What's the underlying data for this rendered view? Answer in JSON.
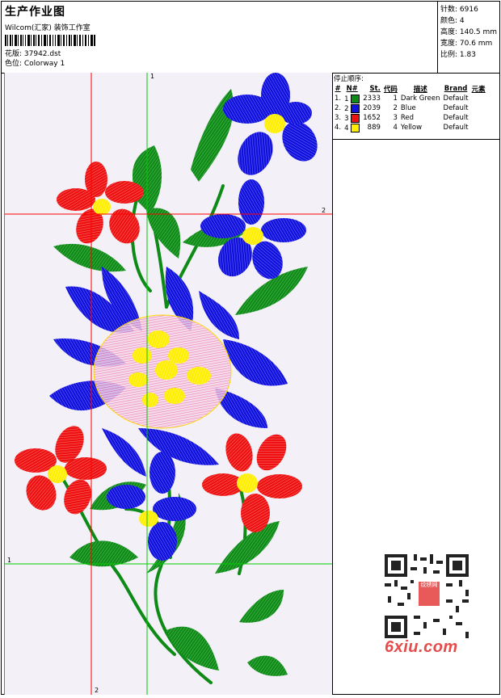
{
  "header": {
    "title": "生产作业图",
    "subtitle": "Wilcom(汇家) 装饰工作室",
    "design_label": "花版: 37942.dst",
    "colorway_label": "色位: Colorway 1"
  },
  "stats": {
    "stitches": "针数: 6916",
    "colors": "颜色: 4",
    "height": "高度: 140.5 mm",
    "width": "宽度: 70.6 mm",
    "scale": "比例: 1.83"
  },
  "stop_sequence": {
    "title": "停止顺序:",
    "columns": [
      "#",
      "N#",
      "St.",
      "代码",
      "描述",
      "Brand",
      "元素"
    ],
    "rows": [
      {
        "idx": "1.",
        "n": "1",
        "color": "#0e8a16",
        "st": "2333",
        "code": "1",
        "desc": "Dark Green",
        "brand": "Default"
      },
      {
        "idx": "2.",
        "n": "2",
        "color": "#1111dd",
        "st": "2039",
        "code": "2",
        "desc": "Blue",
        "brand": "Default"
      },
      {
        "idx": "3.",
        "n": "3",
        "color": "#ee1111",
        "st": "1652",
        "code": "3",
        "desc": "Red",
        "brand": "Default"
      },
      {
        "idx": "4.",
        "n": "4",
        "color": "#ffee00",
        "st": "889",
        "code": "4",
        "desc": "Yellow",
        "brand": "Default"
      }
    ]
  },
  "guides": {
    "v1": "1",
    "h2": "2",
    "h1": "1",
    "v2": "2"
  },
  "watermark": {
    "logo": "6xiu.com",
    "qr_badge": "纹绣网"
  },
  "colors": {
    "green": "#0e8a16",
    "blue": "#1111dd",
    "red": "#ee1111",
    "yellow": "#ffee00",
    "guide_red": "#ff0000",
    "guide_green": "#00cc00"
  }
}
